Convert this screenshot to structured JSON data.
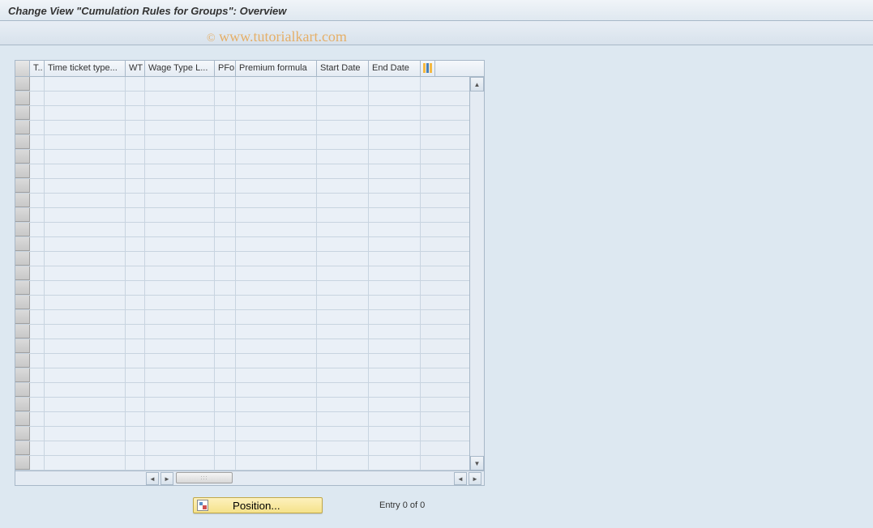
{
  "title": "Change View \"Cumulation Rules for Groups\": Overview",
  "watermark": "www.tutorialkart.com",
  "table": {
    "columns": {
      "t": "T..",
      "tickettype": "Time ticket type...",
      "wt": "WT",
      "wagetypel": "Wage Type L...",
      "pfo": "PFo",
      "premium": "Premium formula",
      "startdate": "Start Date",
      "enddate": "End Date"
    }
  },
  "footer": {
    "position_label": "Position...",
    "entry_status": "Entry 0 of 0"
  }
}
